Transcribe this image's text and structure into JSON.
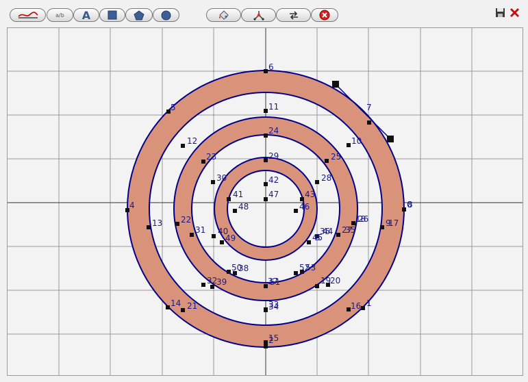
{
  "toolbar": {
    "tools": [
      {
        "name": "curve-tool",
        "icon": "curve-icon"
      },
      {
        "name": "fraction-tool",
        "icon": "fraction-icon",
        "text": "a/b"
      },
      {
        "name": "text-tool",
        "icon": "text-icon",
        "text": "A"
      },
      {
        "name": "rectangle-tool",
        "icon": "square-icon"
      },
      {
        "name": "polygon-tool",
        "icon": "pentagon-icon"
      },
      {
        "name": "circle-tool",
        "icon": "circle-icon"
      },
      {
        "name": "color-tool",
        "icon": "paint-bucket-icon"
      },
      {
        "name": "nodes-tool",
        "icon": "nodes-icon"
      },
      {
        "name": "swap-tool",
        "icon": "swap-arrows-icon"
      },
      {
        "name": "delete-tool",
        "icon": "delete-icon"
      }
    ],
    "window_icons": [
      "save-icon",
      "close-icon"
    ]
  },
  "canvas": {
    "fill_color": "#d9937b",
    "stroke_color": "#00008b",
    "grid_color": "#9a9a9a",
    "rings": [
      {
        "r_outer": 202,
        "r_inner": 170
      },
      {
        "r_outer": 134,
        "r_inner": 108
      },
      {
        "r_outer": 75,
        "r_inner": 56
      }
    ],
    "point_labels": [
      "6",
      "11",
      "24",
      "29",
      "42",
      "47",
      "5",
      "12",
      "23",
      "30",
      "41",
      "48",
      "7",
      "10",
      "25",
      "28",
      "43",
      "46",
      "4",
      "13",
      "22",
      "31",
      "40",
      "49",
      "0",
      "8",
      "9",
      "17",
      "18",
      "26",
      "27",
      "35",
      "36",
      "44",
      "45",
      "3",
      "14",
      "21",
      "32",
      "39",
      "50",
      "38",
      "37",
      "52",
      "53",
      "51",
      "33",
      "34",
      "20",
      "19",
      "1",
      "16",
      "2",
      "15"
    ]
  }
}
